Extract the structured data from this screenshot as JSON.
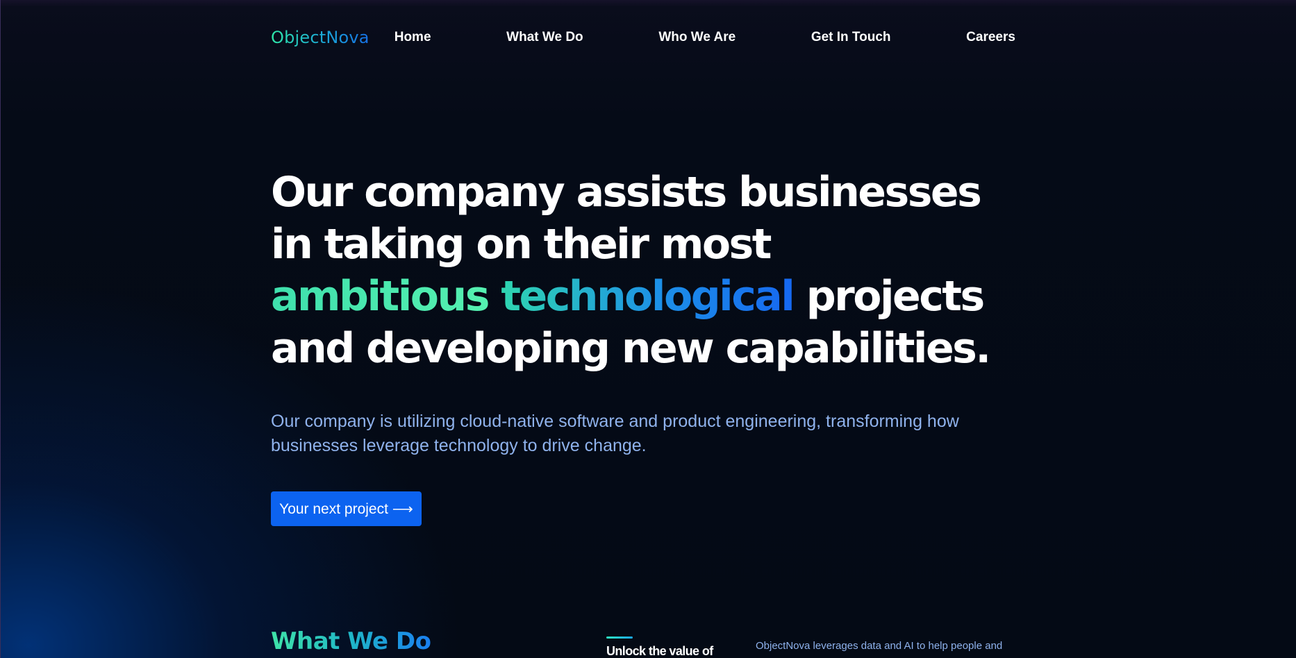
{
  "nav": {
    "logo": "ObjectNova",
    "links": [
      "Home",
      "What We Do",
      "Who We Are",
      "Get In Touch",
      "Careers"
    ]
  },
  "hero": {
    "title_part1": "Our company assists businesses in taking on their most ",
    "title_highlight1": "ambitious",
    "title_highlight2": "technological",
    "title_part2": " projects and developing new capabilities.",
    "subtitle": "Our company is utilizing cloud-native software and product engineering, transforming how businesses leverage technology to drive change.",
    "cta_label": "Your next project ⟶"
  },
  "what_we_do": {
    "title": "What We Do",
    "lead": "Unlock the value of",
    "body": "ObjectNova leverages data and AI to help people and"
  },
  "colors": {
    "background": "#050b17",
    "cta": "#0c63f0",
    "subtitle": "#8fb2ec",
    "accent_green": "#3fe0ad",
    "accent_blue": "#1668f0"
  }
}
